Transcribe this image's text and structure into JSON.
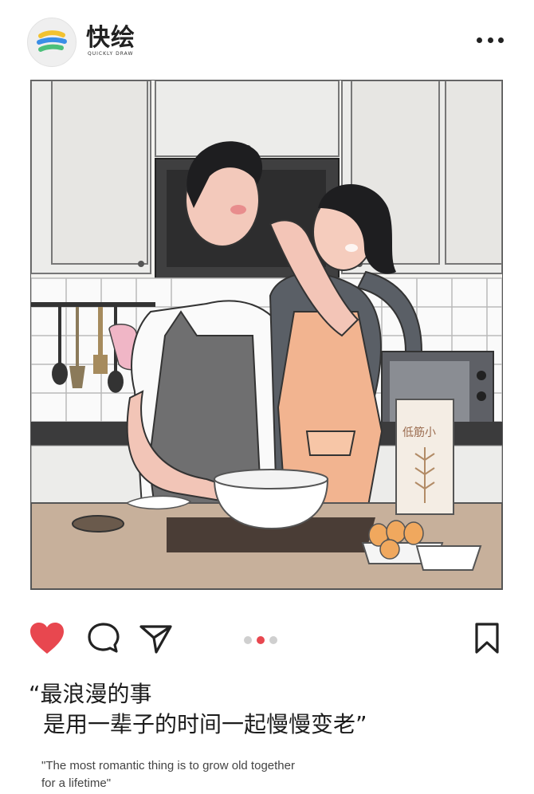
{
  "header": {
    "brand_name": "快绘",
    "brand_sub": "QUICKLY DRAW",
    "logo_icon": "quickly-draw-logo-icon",
    "more_icon": "more-dots-icon"
  },
  "post": {
    "image_alt": "illustration-couple-baking-in-kitchen",
    "flour_bag_label": "低筋小"
  },
  "actions": {
    "like_icon": "heart-filled-icon",
    "comment_icon": "comment-bubble-icon",
    "share_icon": "send-paper-plane-icon",
    "bookmark_icon": "bookmark-icon",
    "carousel_count": 3,
    "carousel_active": 2,
    "colors": {
      "like": "#e8474f",
      "dot_active": "#e8474f",
      "dot_inactive": "#cfcfcf"
    }
  },
  "caption": {
    "line1": "“最浪漫的事",
    "line2": "是用一辈子的时间一起慢慢变老”",
    "english": "\"The most romantic thing is to grow old together for a lifetime\""
  }
}
